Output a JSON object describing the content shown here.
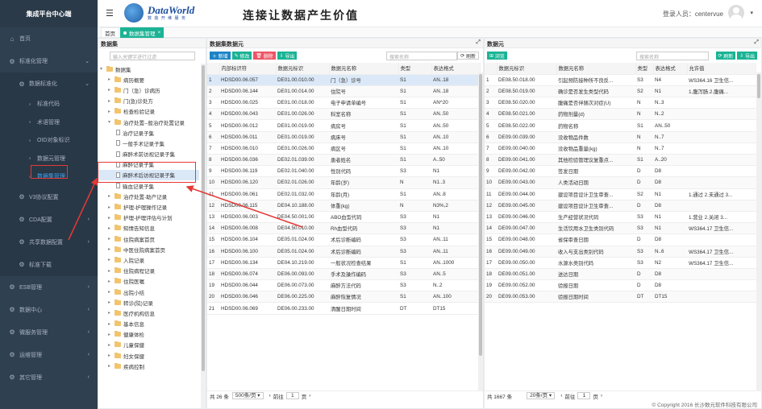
{
  "sidebar": {
    "brand": "集成平台中心端",
    "items": [
      {
        "icon": "home-icon",
        "label": "首页",
        "level": 0
      },
      {
        "icon": "gear-icon",
        "label": "标准化管理",
        "level": 0,
        "chevron": "v"
      },
      {
        "icon": "gear-icon",
        "label": "数据标准化",
        "level": 1,
        "chevron": "v"
      },
      {
        "icon": "circle-icon",
        "label": "标准代码",
        "level": 2
      },
      {
        "icon": "circle-icon",
        "label": "术语管理",
        "level": 2
      },
      {
        "icon": "circle-icon",
        "label": "OID对象标识",
        "level": 2
      },
      {
        "icon": "circle-icon",
        "label": "数据元管理",
        "level": 2
      },
      {
        "icon": "circle-icon",
        "label": "数据集管理",
        "level": 2,
        "selected": true
      },
      {
        "icon": "gear-icon",
        "label": "V3协议配置",
        "level": 1,
        "chevron": "‹"
      },
      {
        "icon": "gear-icon",
        "label": "CDA配置",
        "level": 1,
        "chevron": "‹"
      },
      {
        "icon": "gear-icon",
        "label": "共享数据配置",
        "level": 1,
        "chevron": "‹"
      },
      {
        "icon": "gear-icon",
        "label": "标准下载",
        "level": 1
      },
      {
        "icon": "gear-icon",
        "label": "ESB管理",
        "level": 0,
        "chevron": "‹"
      },
      {
        "icon": "gear-icon",
        "label": "数据中心",
        "level": 0,
        "chevron": "‹"
      },
      {
        "icon": "gear-icon",
        "label": "微服务管理",
        "level": 0,
        "chevron": "‹"
      },
      {
        "icon": "gear-icon",
        "label": "运维管理",
        "level": 0,
        "chevron": "‹"
      },
      {
        "icon": "gear-icon",
        "label": "其它管理",
        "level": 0,
        "chevron": "‹"
      }
    ]
  },
  "header": {
    "logo_name": "DataWorld",
    "logo_sub": "数 鼎 开 维 服 务",
    "slogan": "连接让数据产生价值",
    "login_label": "登录人员：",
    "login_user": "centervue"
  },
  "tabs": {
    "home": "首页",
    "active": "数据集管理",
    "close": "×"
  },
  "tree_panel": {
    "title": "数据集",
    "search_placeholder": "输入关键字进行过滤",
    "nodes": [
      {
        "label": "数据集",
        "depth": 0,
        "type": "folder",
        "arrow": "▾"
      },
      {
        "label": "病历概要",
        "depth": 1,
        "type": "folder",
        "arrow": "›"
      },
      {
        "label": "门（急）诊病历",
        "depth": 1,
        "type": "folder",
        "arrow": "›"
      },
      {
        "label": "门(急)诊处方",
        "depth": 1,
        "type": "folder",
        "arrow": "›"
      },
      {
        "label": "检查检验记录",
        "depth": 1,
        "type": "folder",
        "arrow": "›"
      },
      {
        "label": "治疗处置--般治疗处置记录",
        "depth": 1,
        "type": "folder",
        "arrow": "▾"
      },
      {
        "label": "治疗记录子集",
        "depth": 2,
        "type": "file"
      },
      {
        "label": "一般手术记录子集",
        "depth": 2,
        "type": "file"
      },
      {
        "label": "麻醉术前访视记录子集",
        "depth": 2,
        "type": "file"
      },
      {
        "label": "麻醉记录子集",
        "depth": 2,
        "type": "file"
      },
      {
        "label": "麻醉术后访视记录子集",
        "depth": 2,
        "type": "file",
        "highlight": true
      },
      {
        "label": "输血记录子集",
        "depth": 2,
        "type": "file"
      },
      {
        "label": "治疗处置-助产记录",
        "depth": 1,
        "type": "folder",
        "arrow": "›"
      },
      {
        "label": "护理-护理操作记录",
        "depth": 1,
        "type": "folder",
        "arrow": "›"
      },
      {
        "label": "护理-护理评估与计划",
        "depth": 1,
        "type": "folder",
        "arrow": "›"
      },
      {
        "label": "知情告知信息",
        "depth": 1,
        "type": "folder",
        "arrow": "›"
      },
      {
        "label": "住院病案首页",
        "depth": 1,
        "type": "folder",
        "arrow": "›"
      },
      {
        "label": "中医住院病案首页",
        "depth": 1,
        "type": "folder",
        "arrow": "›"
      },
      {
        "label": "入院记录",
        "depth": 1,
        "type": "folder",
        "arrow": "›"
      },
      {
        "label": "住院病程记录",
        "depth": 1,
        "type": "folder",
        "arrow": "›"
      },
      {
        "label": "住院医嘱",
        "depth": 1,
        "type": "folder",
        "arrow": "›"
      },
      {
        "label": "出院小结",
        "depth": 1,
        "type": "folder",
        "arrow": "›"
      },
      {
        "label": "转诊(院)记录",
        "depth": 1,
        "type": "folder",
        "arrow": "›"
      },
      {
        "label": "医疗机构信息",
        "depth": 1,
        "type": "folder",
        "arrow": "›"
      },
      {
        "label": "基本信息",
        "depth": 1,
        "type": "folder",
        "arrow": "›"
      },
      {
        "label": "健康体检",
        "depth": 1,
        "type": "folder",
        "arrow": "›"
      },
      {
        "label": "儿童保健",
        "depth": 1,
        "type": "folder",
        "arrow": "›"
      },
      {
        "label": "妇女保健",
        "depth": 1,
        "type": "folder",
        "arrow": "›"
      },
      {
        "label": "疾病控制",
        "depth": 1,
        "type": "folder",
        "arrow": "›"
      }
    ]
  },
  "left_table": {
    "title": "数据集数据元",
    "buttons": {
      "add": "新增",
      "edit": "修改",
      "delete": "删除",
      "export": "导出",
      "refresh": "刷新"
    },
    "search_placeholder": "搜索名称",
    "columns": [
      "",
      "内部标识符",
      "数据元标识",
      "数据元名称",
      "类型",
      "表达格式"
    ],
    "rows": [
      [
        "1",
        "HDSD00.06.057",
        "DE01.00.010.00",
        "门（急）诊号",
        "S1",
        "AN..18"
      ],
      [
        "2",
        "HDSD00.06.144",
        "DE01.00.014.00",
        "住院号",
        "S1",
        "AN..18"
      ],
      [
        "3",
        "HDSD00.06.025",
        "DE01.00.018.00",
        "电子申请单编号",
        "S1",
        "AN^20"
      ],
      [
        "4",
        "HDSD00.06.043",
        "DE01.00.026.00",
        "科室名称",
        "S1",
        "AN..50"
      ],
      [
        "5",
        "HDSD00.06.012",
        "DE01.00.019.00",
        "病房号",
        "S1",
        "AN..50"
      ],
      [
        "6",
        "HDSD00.06.011",
        "DE01.00.019.00",
        "病床号",
        "S1",
        "AN..10"
      ],
      [
        "7",
        "HDSD00.06.010",
        "DE01.00.026.00",
        "病区号",
        "S1",
        "AN..10"
      ],
      [
        "8",
        "HDSD00.06.036",
        "DE02.01.039.00",
        "患者姓名",
        "S1",
        "A..50"
      ],
      [
        "9",
        "HDSD00.06.119",
        "DE02.01.040.00",
        "性别代码",
        "S3",
        "N1"
      ],
      [
        "10",
        "HDSD00.06.120",
        "DE02.01.026.00",
        "年龄(岁)",
        "N",
        "N1..3"
      ],
      [
        "11",
        "HDSD00.06.061",
        "DE02.01.032.00",
        "年龄(月)",
        "S1",
        "AN..8"
      ],
      [
        "12",
        "HDSD00.06.115",
        "DE04.10.188.00",
        "体重(kg)",
        "N",
        "N3%,2"
      ],
      [
        "13",
        "HDSD00.06.003",
        "DE04.50.001.00",
        "ABO血型代码",
        "S3",
        "N1"
      ],
      [
        "14",
        "HDSD00.06.008",
        "DE04.50.010.00",
        "Rh血型代码",
        "S3",
        "N1"
      ],
      [
        "15",
        "HDSD00.06.104",
        "DE05.01.024.00",
        "术后诊断编码",
        "S3",
        "AN..11"
      ],
      [
        "16",
        "HDSD00.06.100",
        "DE05.01.024.00",
        "术后诊断编码",
        "S3",
        "AN..11"
      ],
      [
        "17",
        "HDSD00.06.134",
        "DE04.10.219.00",
        "一般状况检查结果",
        "S1",
        "AN..1000"
      ],
      [
        "18",
        "HDSD00.06.074",
        "DE06.00.093.00",
        "手术及操作编码",
        "S3",
        "AN..5"
      ],
      [
        "19",
        "HDSD00.06.044",
        "DE06.00.073.00",
        "麻醉方法代码",
        "S3",
        "N..2"
      ],
      [
        "20",
        "HDSD00.06.046",
        "DE06.00.225.00",
        "麻醉恢复情况",
        "S1",
        "AN..100"
      ],
      [
        "21",
        "HDSD00.06.069",
        "DE06.00.233.00",
        "清醒日期时间",
        "DT",
        "DT15"
      ]
    ],
    "selected_row": 0,
    "pager": {
      "total_label": "共 26 条",
      "page_size": "500条/页",
      "prev": "前往",
      "page": "1",
      "suffix": "页"
    }
  },
  "right_table": {
    "title": "数据元",
    "buttons": {
      "browse": "浏览",
      "refresh": "刷新",
      "export": "导出"
    },
    "search_placeholder": "搜索名称",
    "columns": [
      "",
      "数据元标识",
      "数据元名称",
      "类型",
      "表达格式",
      "允许值"
    ],
    "rows": [
      [
        "1",
        "DE08.50.018.00",
        "引起预防接种所不良反...",
        "S3",
        "N4",
        "WS364.16 卫生信..."
      ],
      [
        "2",
        "DE08.50.019.00",
        "确诊是否发生类型代码",
        "S2",
        "N1",
        "1.腹泻肠.2.腹痛..."
      ],
      [
        "3",
        "DE08.50.020.00",
        "腹痛是否伴随次对症(U)",
        "N",
        "N..3",
        ""
      ],
      [
        "4",
        "DE08.50.021.00",
        "药物剂量(d)",
        "N",
        "N..2",
        ""
      ],
      [
        "5",
        "DE08.50.022.00",
        "药物名称",
        "S1",
        "AN..50",
        ""
      ],
      [
        "6",
        "DE09.00.039.00",
        "没收物品件数",
        "N",
        "N..7",
        ""
      ],
      [
        "7",
        "DE09.00.040.00",
        "没收物品重量(kg)",
        "N",
        "N..7",
        ""
      ],
      [
        "8",
        "DE09.00.041.00",
        "其他检验管理议复重点...",
        "S1",
        "A..20",
        ""
      ],
      [
        "9",
        "DE09.00.042.00",
        "签发日期",
        "D",
        "D8",
        ""
      ],
      [
        "10",
        "DE09.00.043.00",
        "人类活动日期",
        "D",
        "D8",
        ""
      ],
      [
        "11",
        "DE09.00.044.00",
        "建设项目设计卫生审查...",
        "S2",
        "N1",
        "1.通过 2.未通过 3..."
      ],
      [
        "12",
        "DE09.00.045.00",
        "建设项目设计卫生审查...",
        "D",
        "D8",
        ""
      ],
      [
        "13",
        "DE09.00.046.00",
        "生产经营状况代码",
        "S3",
        "N1",
        "1.营业 2.关闭 3..."
      ],
      [
        "14",
        "DE09.00.047.00",
        "生活饮用水卫生类别代码",
        "S3",
        "N1",
        "WS364.17 卫生信..."
      ],
      [
        "15",
        "DE09.00.048.00",
        "省保审查日期",
        "D",
        "D8",
        ""
      ],
      [
        "16",
        "DE09.00.049.00",
        "收入与支出类别代码",
        "S3",
        "N..6",
        "WS364.17 卫生信..."
      ],
      [
        "17",
        "DE09.00.050.00",
        "水源水类别代码",
        "S3",
        "N2",
        "WS364.17 卫生信..."
      ],
      [
        "18",
        "DE09.00.051.00",
        "送达日期",
        "D",
        "D8",
        ""
      ],
      [
        "19",
        "DE09.00.052.00",
        "验报日期",
        "D",
        "D8",
        ""
      ],
      [
        "20",
        "DE09.00.053.00",
        "验报日期时间",
        "DT",
        "DT15",
        ""
      ]
    ],
    "pager": {
      "total_label": "共 1667 条",
      "page_size": "20条/页",
      "prev": "前往",
      "page": "1",
      "suffix": "页"
    }
  },
  "footer": "© Copyright 2016 长沙数元软件科技有限公司",
  "colors": {
    "sidebar": "#2f4050",
    "accent": "#1ab394",
    "primary": "#1c84c6",
    "danger": "#ed5565",
    "annotation": "#e53935"
  }
}
